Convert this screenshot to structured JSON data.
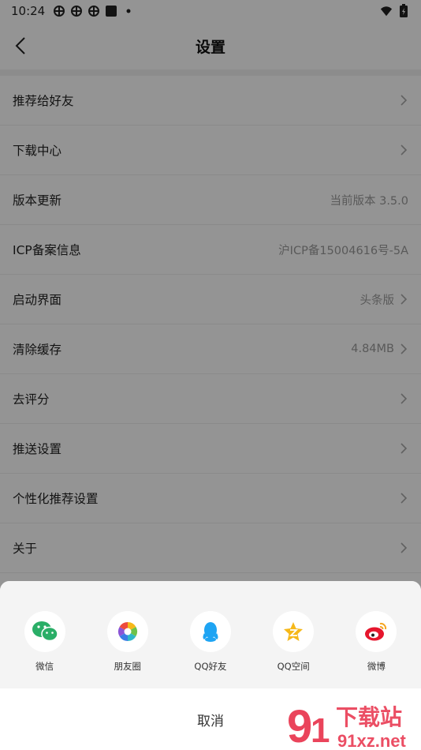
{
  "status_bar": {
    "time": "10:24"
  },
  "header": {
    "title": "设置"
  },
  "settings": [
    {
      "label": "推荐给好友",
      "value": "",
      "chevron": true
    },
    {
      "label": "下载中心",
      "value": "",
      "chevron": true
    },
    {
      "label": "版本更新",
      "value": "当前版本 3.5.0",
      "chevron": false
    },
    {
      "label": "ICP备案信息",
      "value": "沪ICP备15004616号-5A",
      "chevron": false
    },
    {
      "label": "启动界面",
      "value": "头条版",
      "chevron": true
    },
    {
      "label": "清除缓存",
      "value": "4.84MB",
      "chevron": true
    },
    {
      "label": "去评分",
      "value": "",
      "chevron": true
    },
    {
      "label": "推送设置",
      "value": "",
      "chevron": true
    },
    {
      "label": "个性化推荐设置",
      "value": "",
      "chevron": true
    },
    {
      "label": "关于",
      "value": "",
      "chevron": true
    }
  ],
  "share_sheet": {
    "options": [
      {
        "label": "微信",
        "icon": "wechat-icon"
      },
      {
        "label": "朋友圈",
        "icon": "moments-icon"
      },
      {
        "label": "QQ好友",
        "icon": "qq-icon"
      },
      {
        "label": "QQ空间",
        "icon": "qzone-icon"
      },
      {
        "label": "微博",
        "icon": "weibo-icon"
      }
    ],
    "cancel": "取消"
  },
  "watermark": {
    "text1": "下载站",
    "text2": "91xz.net"
  },
  "colors": {
    "wechat": "#2aae67",
    "qq": "#1ea4f3",
    "qzone": "#f6b819",
    "weibo": "#e6162d",
    "overlay": "rgba(0,0,0,0.42)"
  }
}
